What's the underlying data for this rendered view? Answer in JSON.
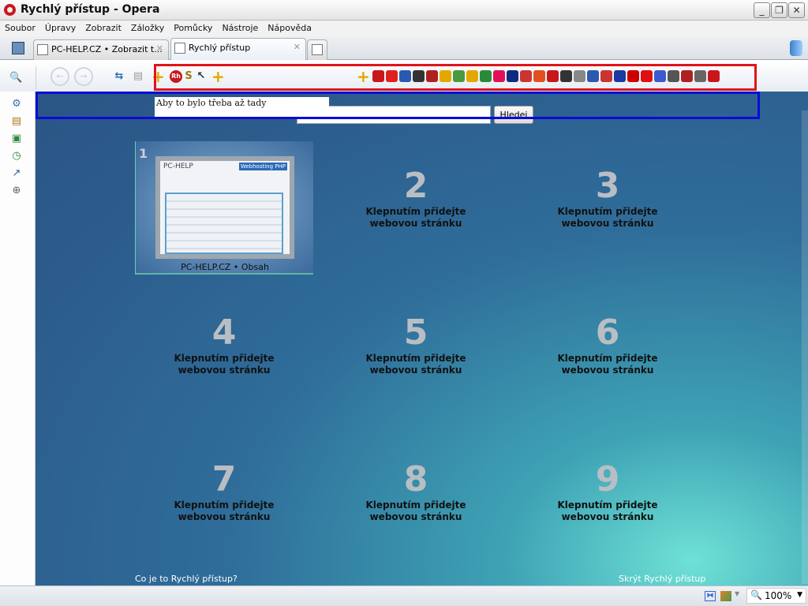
{
  "window": {
    "title": "Rychlý přístup - Opera",
    "controls": [
      "minimize",
      "maximize",
      "close"
    ]
  },
  "menu": [
    "Soubor",
    "Úpravy",
    "Zobrazit",
    "Záložky",
    "Pomůcky",
    "Nástroje",
    "Nápověda"
  ],
  "tabs": [
    {
      "label": "PC-HELP.CZ • Zobrazit t...",
      "active": false
    },
    {
      "label": "Rychlý přístup",
      "active": true
    }
  ],
  "toolbar": {
    "address_value": "",
    "icons": [
      "rozhlas-icon",
      "link-icon",
      "mail-icon",
      "ez-icon",
      "red-square-icon",
      "info-icon",
      "ifl-icon",
      "dictionary-icon",
      "landscape-icon",
      "leaf-icon",
      "circle-d-icon",
      "wd-icon",
      "tv-icon",
      "zoner-icon",
      "rozhlas2-icon",
      "wikipedia-icon",
      "wheel-icon",
      "clock-icon",
      "cc-icon",
      "pct-icon",
      "youtube-icon",
      "s-icon",
      "google-icon",
      "calendar-icon",
      "dictionary2-icon",
      "laptop-icon"
    ]
  },
  "overlay_note": "Aby to bylo třeba až tady",
  "search": {
    "value": "",
    "button": "Hledej"
  },
  "speed_dial": [
    {
      "num": "1",
      "caption": "PC-HELP.CZ • Obsah",
      "filled": true
    },
    {
      "num": "2",
      "caption": "Klepnutím přidejte webovou stránku"
    },
    {
      "num": "3",
      "caption": "Klepnutím přidejte webovou stránku"
    },
    {
      "num": "4",
      "caption": "Klepnutím přidejte webovou stránku"
    },
    {
      "num": "5",
      "caption": "Klepnutím přidejte webovou stránku"
    },
    {
      "num": "6",
      "caption": "Klepnutím přidejte webovou stránku"
    },
    {
      "num": "7",
      "caption": "Klepnutím přidejte webovou stránku"
    },
    {
      "num": "8",
      "caption": "Klepnutím přidejte webovou stránku"
    },
    {
      "num": "9",
      "caption": "Klepnutím přidejte webovou stránku"
    }
  ],
  "thumb1": {
    "logo": "PC-HELP",
    "banner": "Webhosting PHP"
  },
  "links": {
    "about": "Co je to Rychlý přístup?",
    "hide": "Skrýt Rychlý přístup"
  },
  "status": {
    "zoom": "100%"
  },
  "colors": {
    "highlight_red": "#e0141b",
    "highlight_blue": "#0b0bd8"
  }
}
